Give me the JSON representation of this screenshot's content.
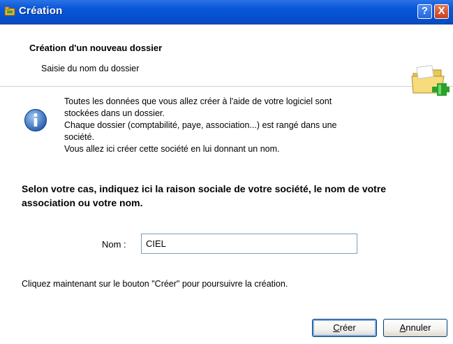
{
  "window": {
    "title": "Création",
    "help_label": "?",
    "close_label": "X"
  },
  "header": {
    "title": "Création d'un nouveau dossier",
    "subtitle": "Saisie du nom du dossier",
    "icon": "folder-add-icon"
  },
  "info": {
    "icon": "info-icon",
    "lines": [
      "Toutes les données que vous allez créer à l'aide de votre logiciel sont",
      "stockées dans un dossier.",
      "Chaque dossier (comptabilité, paye, association...) est rangé dans une",
      "société.",
      "Vous allez ici créer cette société en lui donnant un nom."
    ]
  },
  "question": "Selon votre cas, indiquez ici la raison sociale de votre société, le nom de votre association ou votre nom.",
  "form": {
    "name_label": "Nom :",
    "name_value": "CIEL"
  },
  "instruction": "Cliquez maintenant sur le bouton \"Créer\" pour poursuivre la création.",
  "buttons": {
    "create_first": "C",
    "create_rest": "réer",
    "cancel_first": "A",
    "cancel_rest": "nnuler"
  },
  "colors": {
    "titlebar": "#0a58d8",
    "button_border": "#003c74",
    "input_border": "#7f9db9"
  }
}
